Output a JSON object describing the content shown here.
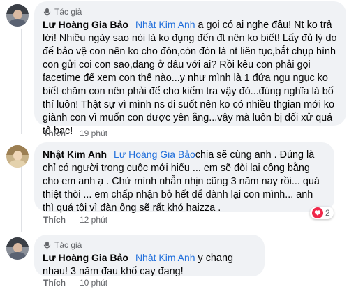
{
  "comments": [
    {
      "badge": "Tác giả",
      "author": "Lư Hoàng Gia Bảo",
      "mention": "Nhật Kim Anh",
      "text_first": " a gọi có ai nghe đâu! Nt",
      "text_rest": "ko trả lời! Nhiều ngày sao nói là ko đụng đến đt nên ko biết! Lấy đủ lý do để bảo vệ con nên ko cho đón,còn đón là nt liên tục,bắt chụp hình con gửi coi con sao,đang ở đâu với ai? Rồi kêu con phải gọi facetime để xem con thế nào...y như mình là 1 đứa ngu ngục ko biết chăm con nên phải để cho kiểm tra vậy đó...đúng nghĩa là bố thí luôn! Thật sự vì mình ns đi suốt nên ko có nhiều thgian mới ko giành con vì muốn con được yên ắng...vậy mà luôn bị đối xử quá tệ bạc!",
      "like": "Thích",
      "time": "19 phút"
    },
    {
      "author": "Nhật Kim Anh",
      "mention": "Lư Hoàng Gia Bảo",
      "text_first": "chia sẽ cùng anh . Đúng là chỉ",
      "text_rest": "có người trong cuộc mới hiểu ... em sẽ đòi lại công bằng cho em anh ạ . Chứ mình nhẫn nhịn cũng 3 năm nay rồi... quá thiệt thòi ... em chấp nhận bỏ hết để dành lại con mình... anh thì quá tội vì đàn ông sẽ rất khó haizza .",
      "like": "Thích",
      "time": "12 phút",
      "reaction_count": "2"
    },
    {
      "badge": "Tác giả",
      "author": "Lư Hoàng Gia Bảo",
      "mention": "Nhật Kim Anh",
      "text_first": " y chang nhau! 3 năm đau",
      "text_rest": "khổ cay đang!",
      "like": "Thích",
      "time": "10 phút"
    }
  ],
  "colors": {
    "bubble": "#f0f2f5",
    "mention": "#216fdb",
    "meta": "#65676b",
    "heart": "#f0284a"
  }
}
